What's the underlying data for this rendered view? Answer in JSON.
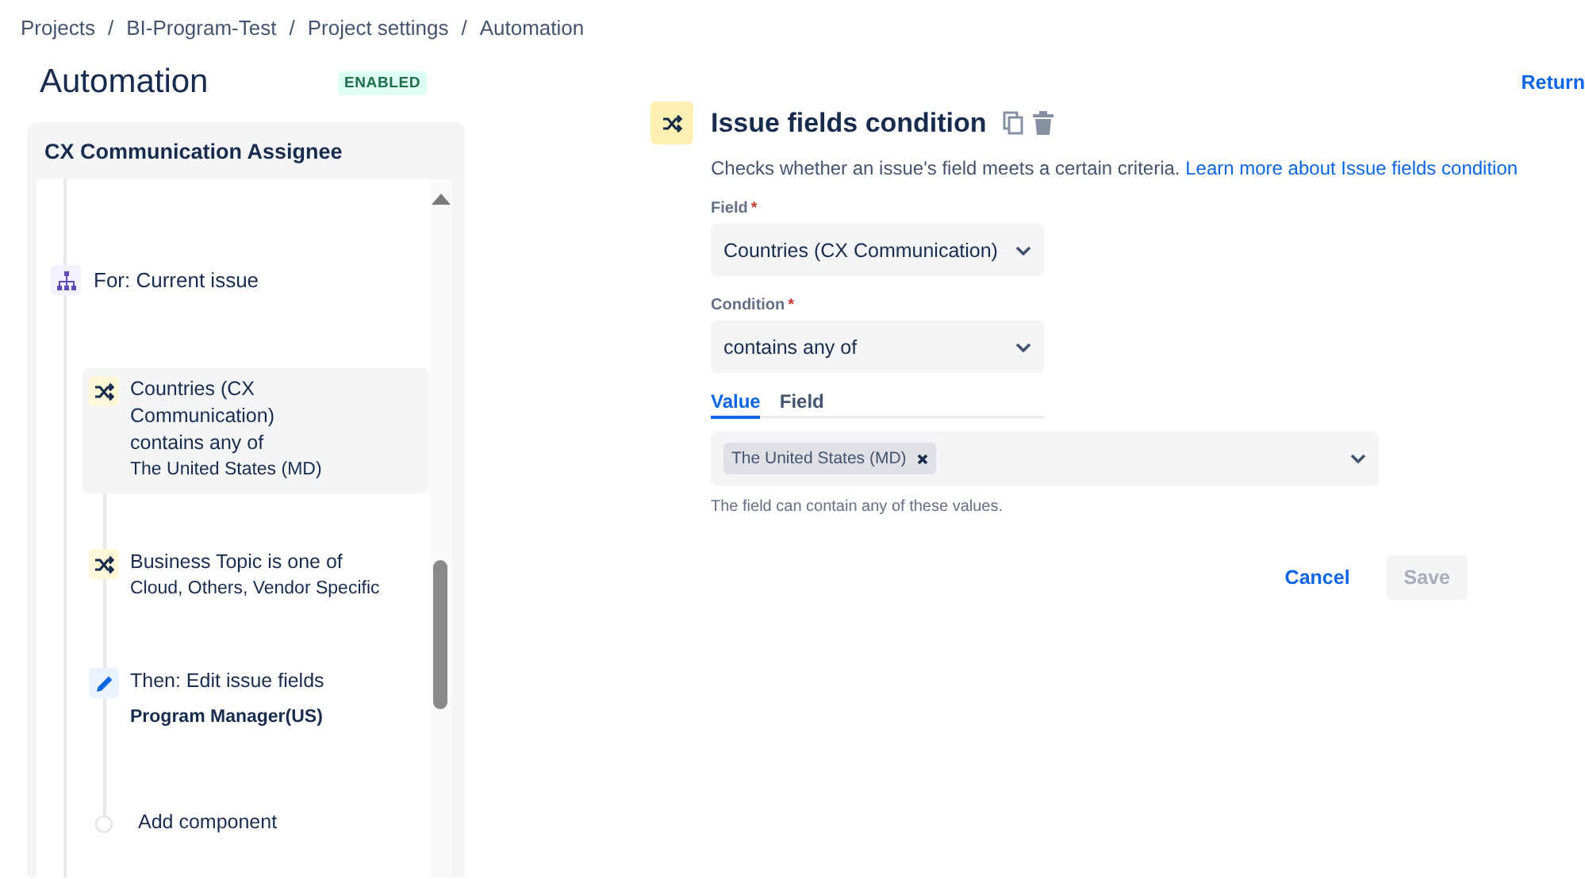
{
  "breadcrumbs": [
    {
      "label": "Projects",
      "separator": "/"
    },
    {
      "label": "BI-Program-Test",
      "separator": "/"
    },
    {
      "label": "Project settings",
      "separator": "/"
    },
    {
      "label": "Automation"
    }
  ],
  "page": {
    "title": "Automation",
    "status": "ENABLED",
    "return_link": "Return"
  },
  "rule": {
    "name": "CX Communication Assignee",
    "components": [
      {
        "kind": "branch",
        "label": "For: Current issue",
        "children": [
          {
            "kind": "condition",
            "label": "Countries (CX Communication) contains any of",
            "detail": "The United States (MD)",
            "selected": true
          },
          {
            "kind": "condition",
            "label": "Business Topic is one of",
            "detail": "Cloud, Others, Vendor Specific",
            "selected": false
          },
          {
            "kind": "action",
            "label": "Then: Edit issue fields",
            "detail": "Program Manager(US)",
            "selected": false
          },
          {
            "kind": "add",
            "label": "Add component"
          }
        ]
      }
    ]
  },
  "panel": {
    "title": "Issue fields condition",
    "description": "Checks whether an issue's field meets a certain criteria.",
    "learn_more_link": "Learn more about Issue fields condition",
    "fields": [
      {
        "label": "Field",
        "required_mark": "*",
        "value": "Countries (CX Communication)"
      },
      {
        "label": "Condition",
        "required_mark": "*",
        "value": "contains any of"
      }
    ],
    "value_tabs": [
      {
        "label": "Value",
        "selected": true
      },
      {
        "label": "Field",
        "selected": false
      }
    ],
    "values": [
      "The United States (MD)"
    ],
    "help": "The field can contain any of these values.",
    "buttons": [
      {
        "label": "Cancel",
        "kind": "link",
        "disabled": false
      },
      {
        "label": "Save",
        "kind": "primary",
        "disabled": true
      }
    ]
  }
}
